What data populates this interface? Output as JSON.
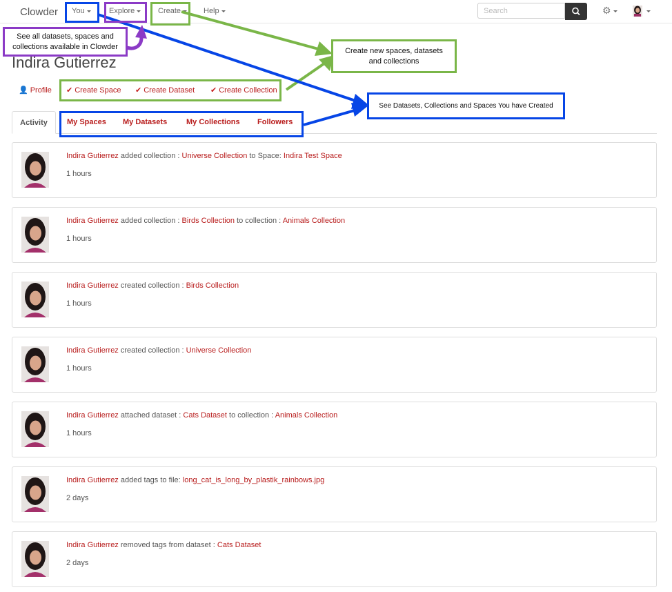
{
  "navbar": {
    "brand": "Clowder",
    "items": [
      {
        "label": "You"
      },
      {
        "label": "Explore"
      },
      {
        "label": "Create"
      },
      {
        "label": "Help"
      }
    ],
    "search_placeholder": "Search"
  },
  "profile": {
    "name": "Indira Gutierrez",
    "profile_link": "Profile",
    "actions": [
      "Create Space",
      "Create Dataset",
      "Create Collection"
    ]
  },
  "tabs": [
    {
      "label": "Activity"
    },
    {
      "label": "My Spaces"
    },
    {
      "label": "My Datasets"
    },
    {
      "label": "My Collections"
    },
    {
      "label": "Followers"
    }
  ],
  "activities": [
    {
      "user": "Indira Gutierrez",
      "p1": " added collection : ",
      "o1": "Universe Collection",
      "p2": " to Space: ",
      "o2": "Indira Test Space",
      "time": "1 hours"
    },
    {
      "user": "Indira Gutierrez",
      "p1": " added collection : ",
      "o1": "Birds Collection",
      "p2": " to collection : ",
      "o2": "Animals Collection",
      "time": "1 hours"
    },
    {
      "user": "Indira Gutierrez",
      "p1": " created collection : ",
      "o1": "Birds Collection",
      "p2": "",
      "o2": "",
      "time": "1 hours"
    },
    {
      "user": "Indira Gutierrez",
      "p1": " created collection : ",
      "o1": "Universe Collection",
      "p2": "",
      "o2": "",
      "time": "1 hours"
    },
    {
      "user": "Indira Gutierrez",
      "p1": " attached dataset : ",
      "o1": "Cats Dataset",
      "p2": " to collection : ",
      "o2": "Animals Collection",
      "time": "1 hours"
    },
    {
      "user": "Indira Gutierrez",
      "p1": " added tags to file: ",
      "o1": "long_cat_is_long_by_plastik_rainbows.jpg",
      "p2": "",
      "o2": "",
      "time": "2 days"
    },
    {
      "user": "Indira Gutierrez",
      "p1": " removed tags from dataset : ",
      "o1": "Cats Dataset",
      "p2": "",
      "o2": "",
      "time": "2 days"
    }
  ],
  "annotations": {
    "explore_note": "See all datasets, spaces and collections available in Clowder",
    "create_note": "Create new spaces, datasets and collections",
    "you_note": "See Datasets, Collections and Spaces You have Created"
  },
  "colors": {
    "link": "#b81c1c",
    "annotation_blue": "#0645e6",
    "annotation_purple": "#8b3ac6",
    "annotation_green": "#7ab648"
  }
}
